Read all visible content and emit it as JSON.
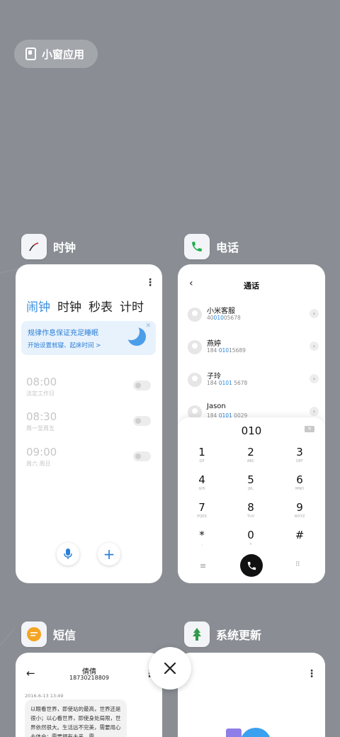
{
  "floating_button": {
    "label": "小窗应用"
  },
  "clock": {
    "app_name": "时钟",
    "tabs": [
      "闹钟",
      "时钟",
      "秒表",
      "计时"
    ],
    "banner": {
      "title": "规律作息保证充足睡眠",
      "subtitle": "开始设置就寝、起床时间 >"
    },
    "alarms": [
      {
        "time": "08:00",
        "desc": "法定工作日"
      },
      {
        "time": "08:30",
        "desc": "周一至周五"
      },
      {
        "time": "09:00",
        "desc": "周六 周日"
      }
    ]
  },
  "phone": {
    "app_name": "电话",
    "title": "通话",
    "contacts": [
      {
        "name": "小米客服",
        "num_pre": "40",
        "num_hl": "010",
        "num_post": "05678"
      },
      {
        "name": "燕婷",
        "num_pre": "184 ",
        "num_hl": "010",
        "num_post": "15689"
      },
      {
        "name": "子玲",
        "num_pre": "184 ",
        "num_hl": "0101",
        "num_post": " 5678"
      },
      {
        "name": "Jason",
        "num_pre": "184 ",
        "num_hl": "0101",
        "num_post": " 0029"
      }
    ],
    "dial_input": "010",
    "keys": [
      {
        "d": "1",
        "l": "QP"
      },
      {
        "d": "2",
        "l": "ABC"
      },
      {
        "d": "3",
        "l": "DEF"
      },
      {
        "d": "4",
        "l": "GHI"
      },
      {
        "d": "5",
        "l": "JKL"
      },
      {
        "d": "6",
        "l": "MNO"
      },
      {
        "d": "7",
        "l": "PQRS"
      },
      {
        "d": "8",
        "l": "TUV"
      },
      {
        "d": "9",
        "l": "WXYZ"
      },
      {
        "d": "*",
        "l": ","
      },
      {
        "d": "0",
        "l": "+"
      },
      {
        "d": "#",
        "l": ""
      }
    ]
  },
  "sms": {
    "app_name": "短信",
    "contact_name": "倩倩",
    "contact_number": "18730218809",
    "date": "2016-6-13 13:49",
    "message": "以眼看世界，即使站的最高，世界还是很小；以心看世界，即使身处局限，世界依然很大。生活远不完美，需要用心去体会；需要拥有未来，需"
  },
  "update": {
    "app_name": "系统更新"
  },
  "colors": {
    "background": "#8a8e94",
    "accent": "#3b8fe0",
    "phone_green": "#1aad4b",
    "sms_orange": "#f5a524",
    "update_green": "#2f9b4a"
  }
}
